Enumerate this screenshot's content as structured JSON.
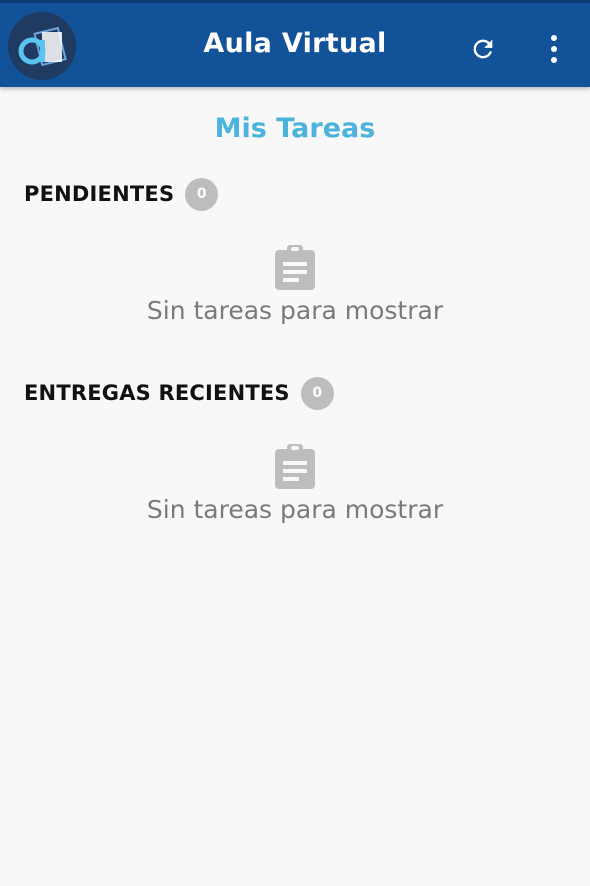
{
  "appbar": {
    "title": "Aula Virtual",
    "logo_icon": "aula-virtual-logo",
    "refresh_icon": "refresh-icon",
    "menu_icon": "more-vert-icon",
    "background_color": "#115299"
  },
  "main": {
    "title": "Mis Tareas",
    "title_color": "#4bb3dc",
    "sections": [
      {
        "label": "PENDIENTES",
        "count": "0",
        "empty_icon": "clipboard-icon",
        "empty_text": "Sin tareas para mostrar"
      },
      {
        "label": "ENTREGAS RECIENTES",
        "count": "0",
        "empty_icon": "clipboard-icon",
        "empty_text": "Sin tareas para mostrar"
      }
    ]
  }
}
